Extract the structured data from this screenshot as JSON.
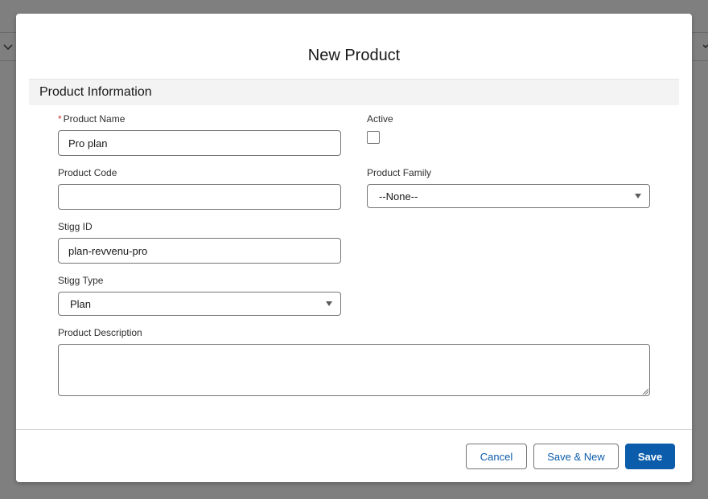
{
  "modal": {
    "title": "New Product"
  },
  "section": {
    "title": "Product Information"
  },
  "fields": {
    "product_name": {
      "label": "Product Name",
      "required_mark": "*",
      "value": "Pro plan"
    },
    "active": {
      "label": "Active",
      "checked": false
    },
    "product_code": {
      "label": "Product Code",
      "value": ""
    },
    "product_family": {
      "label": "Product Family",
      "selected": "--None--"
    },
    "stigg_id": {
      "label": "Stigg ID",
      "value": "plan-revvenu-pro"
    },
    "stigg_type": {
      "label": "Stigg Type",
      "selected": "Plan"
    },
    "product_description": {
      "label": "Product Description",
      "value": ""
    }
  },
  "footer": {
    "cancel_label": "Cancel",
    "save_new_label": "Save & New",
    "save_label": "Save"
  },
  "colors": {
    "brand": "#0b5cab",
    "required": "#c23934",
    "backdrop": "#7f7f7f",
    "section_bg": "#f3f3f3"
  },
  "icons": {
    "dropdown": "chevron-down-icon",
    "close": "close-icon",
    "resize": "resize-grip-icon"
  }
}
